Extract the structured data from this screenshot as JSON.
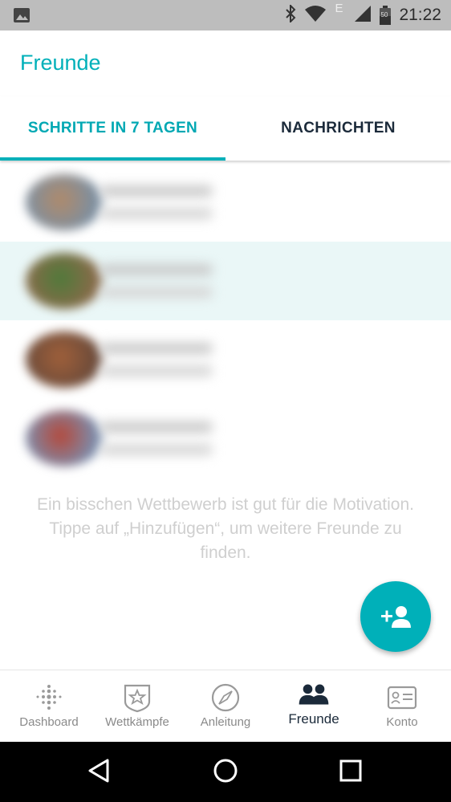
{
  "status_bar": {
    "time": "21:22",
    "network_letter": "E",
    "battery_level": "50",
    "icons": [
      "gallery-icon",
      "bluetooth-icon",
      "wifi-icon",
      "cell-signal-icon",
      "battery-icon"
    ]
  },
  "app_bar": {
    "title": "Freunde"
  },
  "tabs": [
    {
      "label": "SCHRITTE IN 7 TAGEN",
      "selected": true
    },
    {
      "label": "NACHRICHTEN",
      "selected": false
    }
  ],
  "friends": [
    {
      "highlighted": false,
      "avatar_colors": [
        "#b08a6a",
        "#7a8fa3"
      ]
    },
    {
      "highlighted": true,
      "avatar_colors": [
        "#4f7a3a",
        "#8a6a4a"
      ]
    },
    {
      "highlighted": false,
      "avatar_colors": [
        "#a0603a",
        "#6a4a3a"
      ]
    },
    {
      "highlighted": false,
      "avatar_colors": [
        "#b5483a",
        "#7a8fb0"
      ]
    }
  ],
  "empty_state": {
    "text": "Ein bisschen Wettbewerb ist gut für die Motivation. Tippe auf „Hinzufügen“, um weitere Freunde zu finden."
  },
  "fab": {
    "icon": "add-friend-icon"
  },
  "bottom_nav": [
    {
      "label": "Dashboard",
      "icon": "dashboard-icon",
      "active": false
    },
    {
      "label": "Wettkämpfe",
      "icon": "challenges-icon",
      "active": false
    },
    {
      "label": "Anleitung",
      "icon": "compass-icon",
      "active": false
    },
    {
      "label": "Freunde",
      "icon": "friends-icon",
      "active": true
    },
    {
      "label": "Konto",
      "icon": "account-icon",
      "active": false
    }
  ],
  "system_nav": {
    "icons": [
      "back-icon",
      "home-icon",
      "recents-icon"
    ]
  },
  "colors": {
    "accent": "#00b0b9",
    "highlight_row": "#eaf7f7",
    "dark_text": "#1b2a3a",
    "muted_text": "#8a8a8a"
  }
}
